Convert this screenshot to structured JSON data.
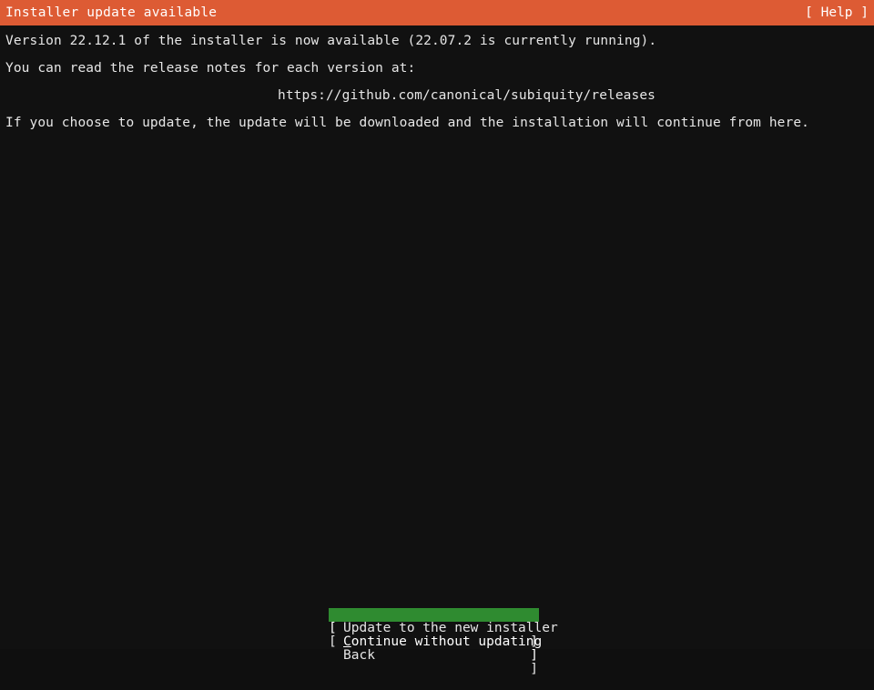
{
  "header": {
    "title": "Installer update available",
    "help_label": "[ Help ]"
  },
  "body": {
    "lines": [
      "Version 22.12.1 of the installer is now available (22.07.2 is currently running).",
      "You can read the release notes for each version at:",
      "https://github.com/canonical/subiquity/releases",
      "If you choose to update, the update will be downloaded and the installation will continue from here."
    ]
  },
  "buttons": {
    "bracket_open": "[",
    "bracket_close": "]",
    "items": [
      {
        "label": "Update to the new installer",
        "accel": "",
        "rest": "Update to the new installer",
        "selected": false
      },
      {
        "label": "Continue without updating",
        "accel": "C",
        "rest": "ontinue without updating",
        "selected": true
      },
      {
        "label": "Back",
        "accel": "",
        "rest": "Back",
        "selected": false
      }
    ]
  },
  "colors": {
    "header_bg": "#dd5b34",
    "screen_bg": "#111111",
    "text": "#e6e6e6",
    "selection_bg": "#2f8b30",
    "selection_text": "#ffffff"
  }
}
